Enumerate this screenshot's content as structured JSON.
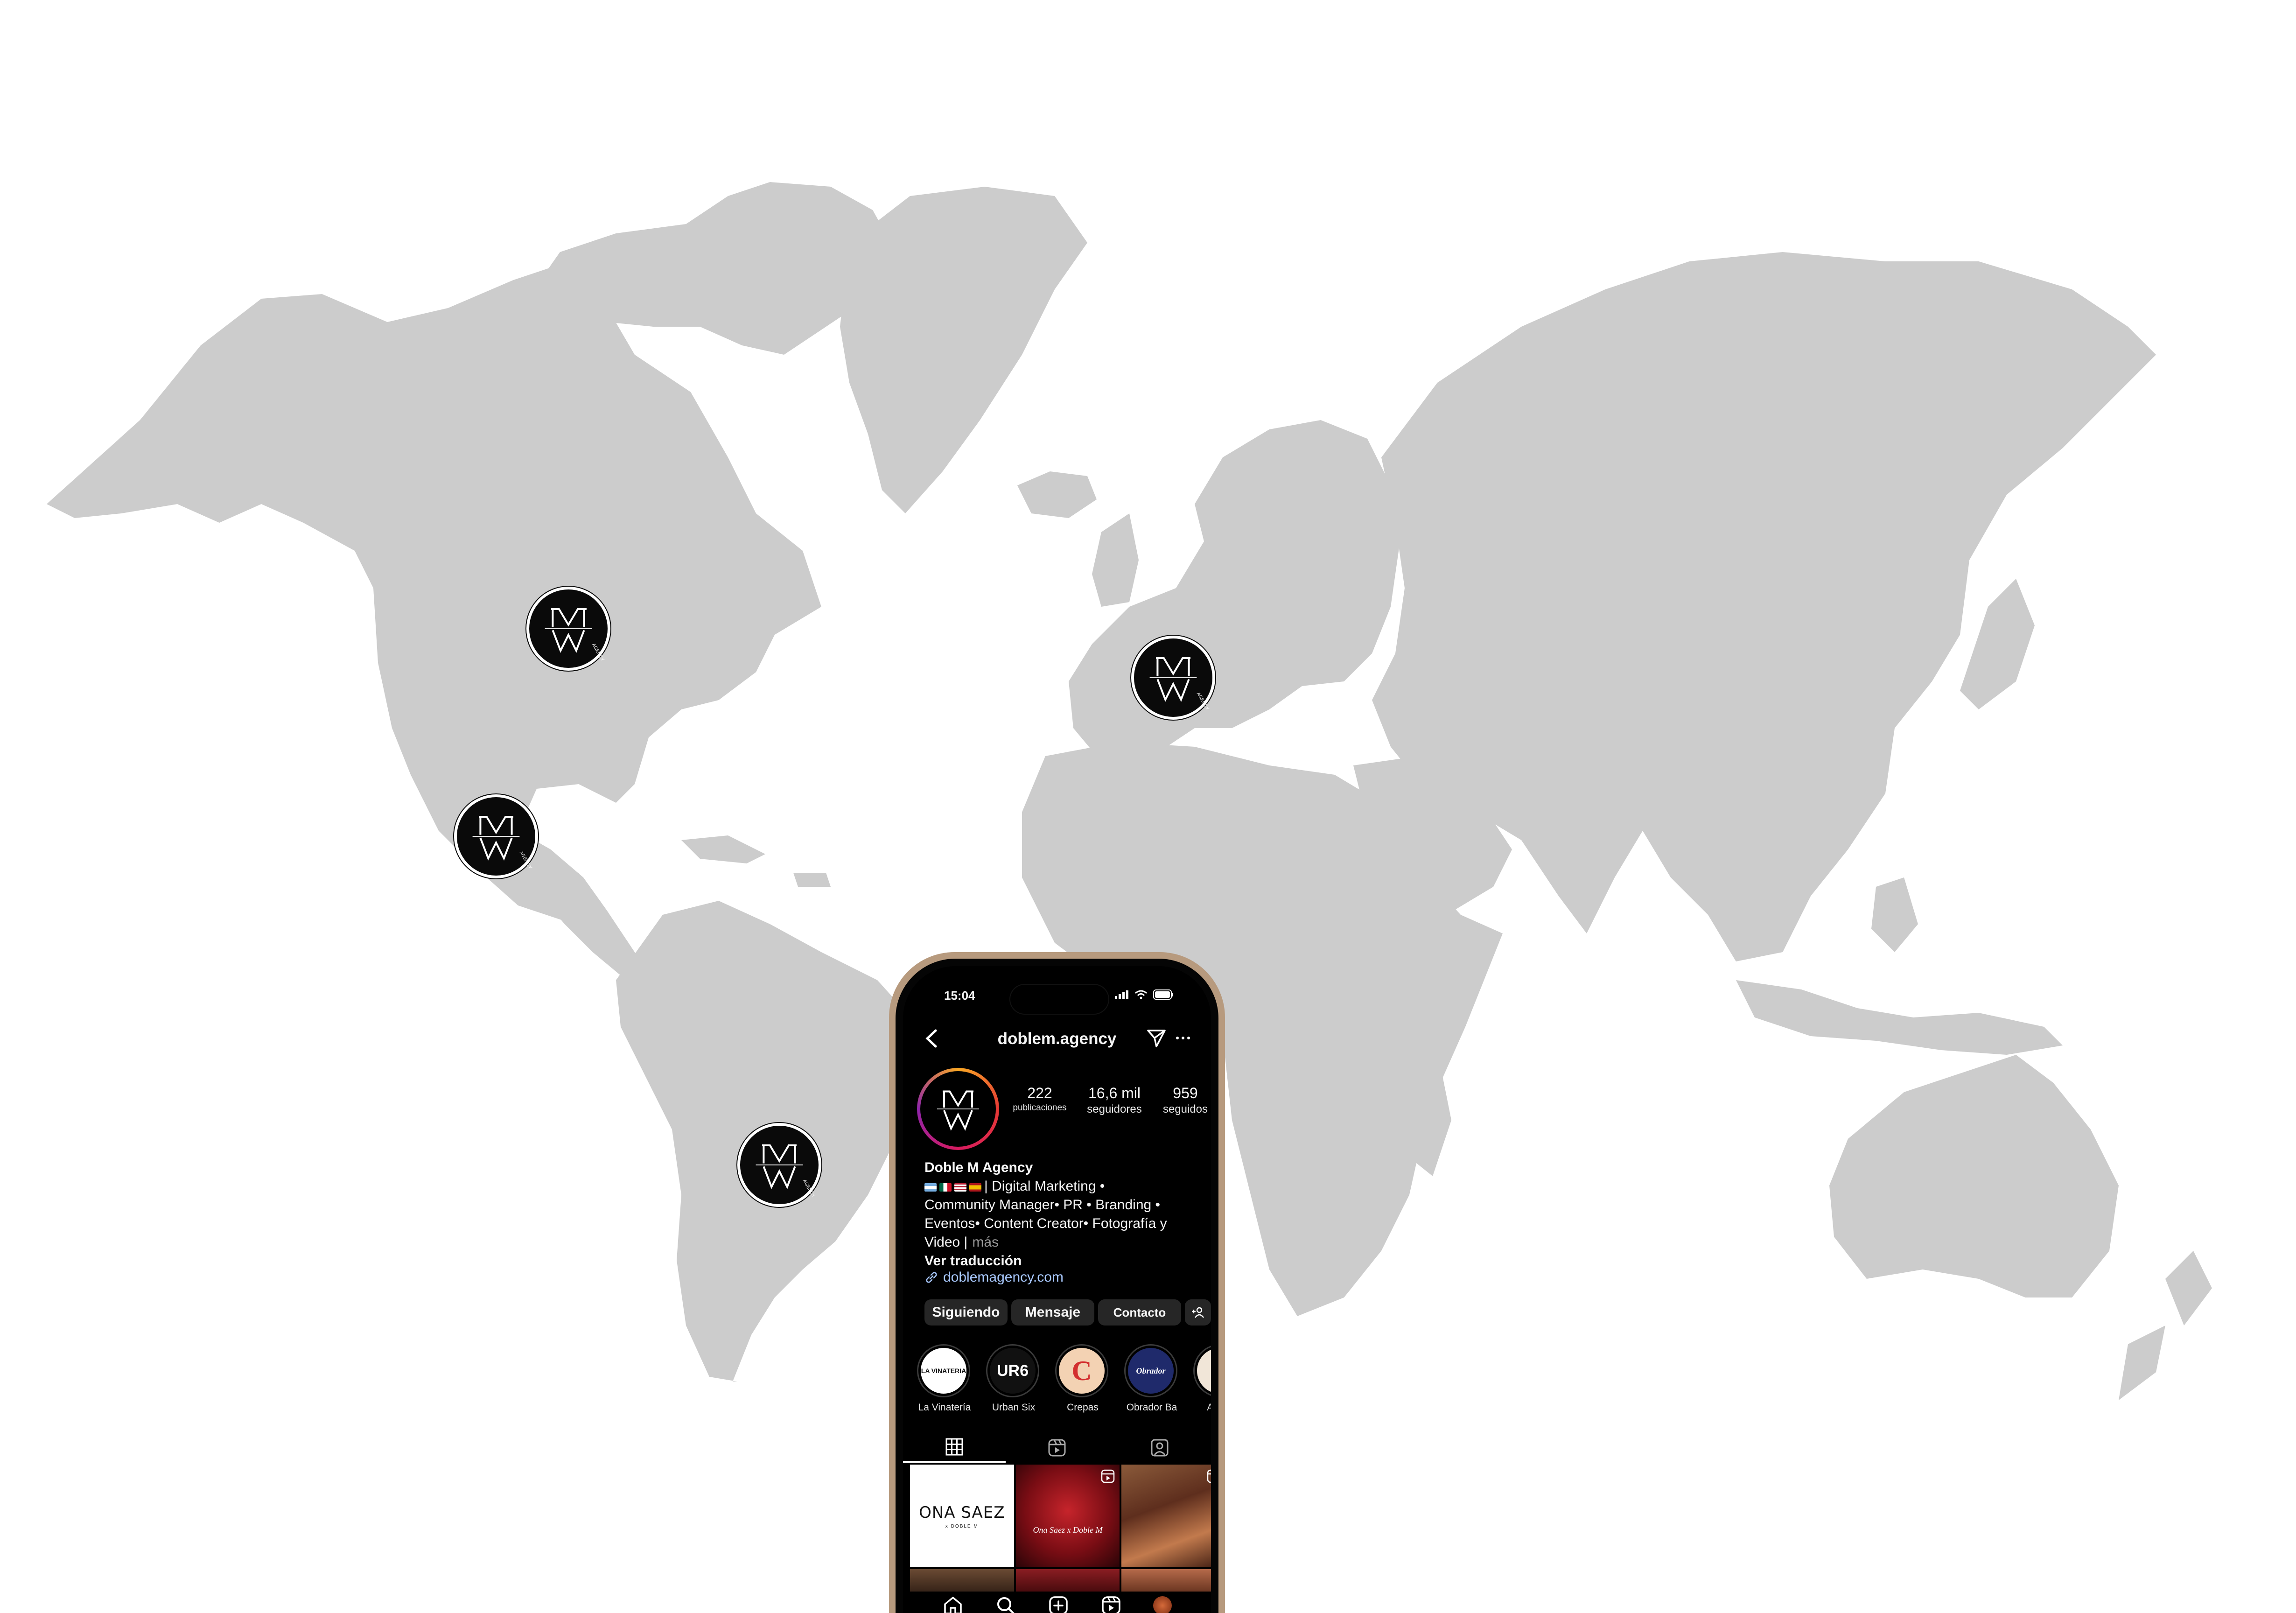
{
  "map": {
    "land_color": "#cccccc",
    "marker_icon": "doble-m-agency-logo",
    "markers": [
      "north-america",
      "mexico",
      "south-america",
      "europe"
    ]
  },
  "phone": {
    "status": {
      "time": "15:04"
    },
    "topbar": {
      "username": "doblem.agency"
    },
    "profile": {
      "stats": [
        {
          "value": "222",
          "label": "publicaciones"
        },
        {
          "value": "16,6 mil",
          "label": "seguidores"
        },
        {
          "value": "959",
          "label": "seguidos"
        }
      ],
      "name": "Doble M Agency",
      "bio_line1": "| Digital Marketing •",
      "bio_line2": "Community Manager• PR • Branding •",
      "bio_line3": "Eventos• Content Creator• Fotografía y",
      "bio_line4": "Video |",
      "more": "más",
      "translate": "Ver traducción",
      "link": "doblemagency.com"
    },
    "buttons": {
      "following": "Siguiendo",
      "message": "Mensaje",
      "contact": "Contacto"
    },
    "highlights": [
      {
        "label": "La Vinatería",
        "art": "LA VINATERIA",
        "color": "#ffffff"
      },
      {
        "label": "Urban Six",
        "art": "UR6",
        "color": "#111111"
      },
      {
        "label": "Crepas",
        "art": "C",
        "color": "#f3d2b3"
      },
      {
        "label": "Obrador Ba",
        "art": "Obrador",
        "color": "#1f2a6b"
      },
      {
        "label": "Antoni",
        "art": "",
        "color": "#f1e6d8"
      }
    ],
    "posts": {
      "first_brand": "ONA SAEZ",
      "first_sub": "x DOBLE M",
      "second_caption": "Ona Saez x Doble M"
    }
  }
}
